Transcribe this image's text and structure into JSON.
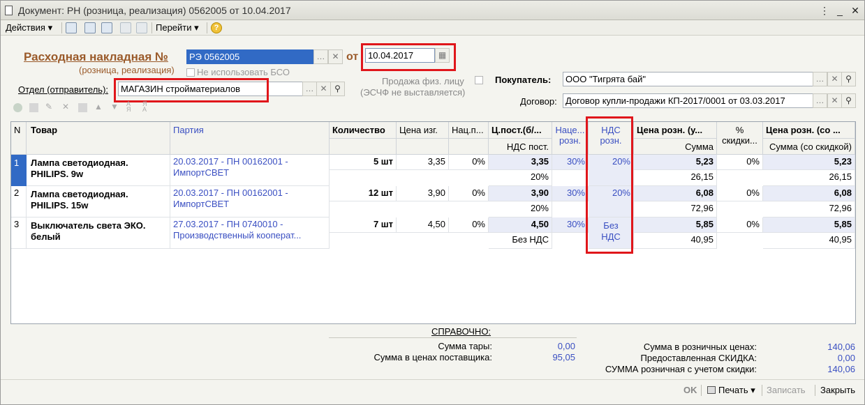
{
  "window": {
    "title": "Документ: РН (розница, реализация) 0562005 от 10.04.2017"
  },
  "toolbar": {
    "actions": "Действия",
    "goto": "Перейти",
    "help": "?"
  },
  "header": {
    "doc_title": "Расходная накладная №",
    "doc_subtitle": "(розница, реализация)",
    "doc_number": "РЭ 0562005",
    "from_label": "от",
    "date": "10.04.2017",
    "no_bso": "Не использовать БСО",
    "dept_label": "Отдел (отправитель):",
    "dept_value": "МАГАЗИН стройматериалов",
    "retail_person": "Продажа физ. лицу",
    "no_invoice": "(ЭСЧФ не выставляется)",
    "buyer_label": "Покупатель:",
    "buyer_value": "ООО \"Тигрята бай\"",
    "contract_label": "Договор:",
    "contract_value": "Договор купли-продажи КП-2017/0001 от 03.03.2017"
  },
  "columns": {
    "n": "N",
    "product": "Товар",
    "batch": "Партия",
    "qty": "Количество",
    "mfr_price": "Цена изг.",
    "markup_pct": "Нац.п...",
    "supply_price": "Ц.пост.(б/...",
    "vat_in": "НДС пост.",
    "retail_markup": "Наце... розн.",
    "retail_vat": "НДС розн.",
    "retail_price": "Цена розн. (у...",
    "sum": "Сумма",
    "discount_pct": "% скидки...",
    "retail_price_disc": "Цена розн. (со ...",
    "sum_disc": "Сумма (со скидкой)"
  },
  "rows": [
    {
      "n": "1",
      "product": "Лампа светодиодная. PHILIPS. 9w",
      "batch": "20.03.2017 - ПН 00162001 - ИмпортСВЕТ",
      "qty": "5 шт",
      "mfr": "3,35",
      "markup": "0%",
      "supply": "3,35",
      "vat_in": "20%",
      "rmarkup": "30%",
      "rvat": "20%",
      "rprice": "5,23",
      "sum": "26,15",
      "disc": "0%",
      "rprice_disc": "5,23",
      "sum_disc": "26,15"
    },
    {
      "n": "2",
      "product": "Лампа светодиодная. PHILIPS. 15w",
      "batch": "20.03.2017 - ПН 00162001 - ИмпортСВЕТ",
      "qty": "12 шт",
      "mfr": "3,90",
      "markup": "0%",
      "supply": "3,90",
      "vat_in": "20%",
      "rmarkup": "30%",
      "rvat": "20%",
      "rprice": "6,08",
      "sum": "72,96",
      "disc": "0%",
      "rprice_disc": "6,08",
      "sum_disc": "72,96"
    },
    {
      "n": "3",
      "product": "Выключатель света ЭКО. белый",
      "batch": "27.03.2017 - ПН 0740010 - Производственный кооперат...",
      "qty": "7 шт",
      "mfr": "4,50",
      "markup": "0%",
      "supply": "4,50",
      "vat_in": "Без НДС",
      "rmarkup": "30%",
      "rvat": "Без НДС",
      "rprice": "5,85",
      "sum": "40,95",
      "disc": "0%",
      "rprice_disc": "5,85",
      "sum_disc": "40,95"
    }
  ],
  "reference": {
    "title": "СПРАВОЧНО:",
    "tare_label": "Сумма тары:",
    "tare_value": "0,00",
    "supplier_label": "Сумма в ценах поставщика:",
    "supplier_value": "95,05"
  },
  "totals": {
    "retail_label": "Сумма в розничных ценах:",
    "retail_value": "140,06",
    "discount_label": "Предоставленная СКИДКА:",
    "discount_value": "0,00",
    "final_label": "СУММА розничная с учетом скидки:",
    "final_value": "140,06"
  },
  "buttons": {
    "ok": "OK",
    "print": "Печать",
    "save": "Записать",
    "close": "Закрыть"
  }
}
